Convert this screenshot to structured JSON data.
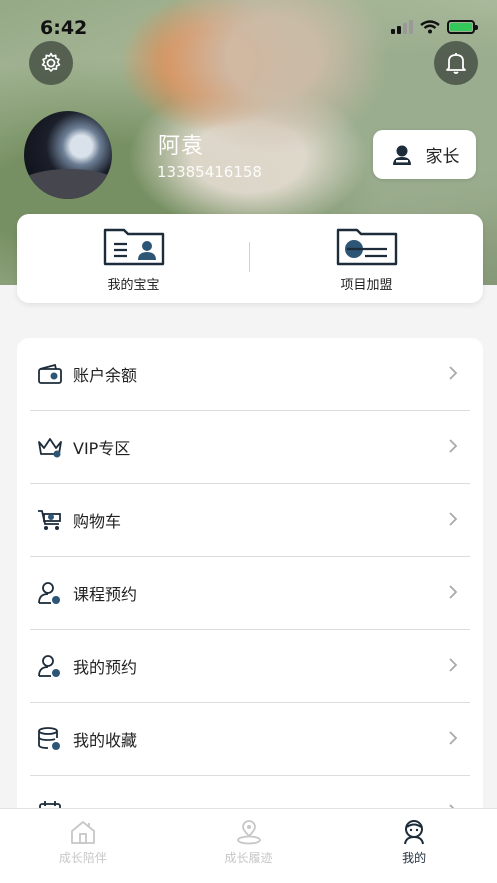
{
  "status": {
    "time": "6:42"
  },
  "profile": {
    "name": "阿袁",
    "phone": "13385416158",
    "role": "家长"
  },
  "quick_actions": [
    {
      "label": "我的宝宝",
      "icon": "id-card-icon"
    },
    {
      "label": "项目加盟",
      "icon": "folder-card-icon"
    }
  ],
  "menu": [
    {
      "label": "账户余额",
      "icon": "wallet-icon"
    },
    {
      "label": "VIP专区",
      "icon": "crown-icon"
    },
    {
      "label": "购物车",
      "icon": "cart-icon"
    },
    {
      "label": "课程预约",
      "icon": "user-booking-icon"
    },
    {
      "label": "我的预约",
      "icon": "user-booking-icon"
    },
    {
      "label": "我的收藏",
      "icon": "stack-icon"
    },
    {
      "label": "",
      "icon": "calendar-icon"
    }
  ],
  "tabs": [
    {
      "label": "成长陪伴",
      "icon": "house-icon",
      "active": false
    },
    {
      "label": "成长履迹",
      "icon": "location-icon",
      "active": false
    },
    {
      "label": "我的",
      "icon": "profile-icon",
      "active": true
    }
  ],
  "colors": {
    "accent": "#1d2c3a",
    "dot": "#2d5575",
    "inactive_tab": "#c7c7c7"
  }
}
